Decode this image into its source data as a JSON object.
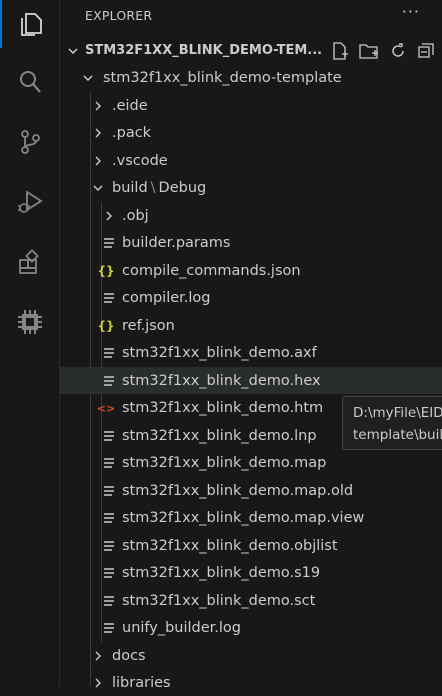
{
  "sidebar": {
    "title": "EXPLORER",
    "more": "···"
  },
  "section": {
    "title": "STM32F1XX_BLINK_DEMO-TEM..."
  },
  "tree": {
    "root": "stm32f1xx_blink_demo-template",
    "eide": ".eide",
    "pack": ".pack",
    "vscode": ".vscode",
    "build": "build",
    "build_sep": "\\",
    "build_debug": "Debug",
    "obj": ".obj",
    "f1": "builder.params",
    "f2": "compile_commands.json",
    "f3": "compiler.log",
    "f4": "ref.json",
    "f5": "stm32f1xx_blink_demo.axf",
    "f6": "stm32f1xx_blink_demo.hex",
    "f7": "stm32f1xx_blink_demo.htm",
    "f8": "stm32f1xx_blink_demo.lnp",
    "f9": "stm32f1xx_blink_demo.map",
    "f10": "stm32f1xx_blink_demo.map.old",
    "f11": "stm32f1xx_blink_demo.map.view",
    "f12": "stm32f1xx_blink_demo.objlist",
    "f13": "stm32f1xx_blink_demo.s19",
    "f14": "stm32f1xx_blink_demo.sct",
    "f15": "unify_builder.log",
    "docs": "docs",
    "libraries": "libraries"
  },
  "tooltip": {
    "line1": "D:\\myFile\\EID",
    "line2": "template\\buil"
  },
  "icons": {
    "json_glyph": "{}",
    "html_glyph": "<>",
    "json_color": "#cbcb41",
    "html_color": "#e44d26"
  }
}
